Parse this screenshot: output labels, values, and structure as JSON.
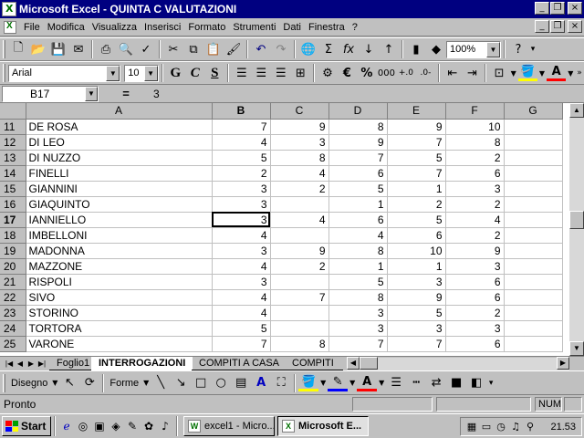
{
  "window": {
    "title": "Microsoft Excel - QUINTA C VALUTAZIONI"
  },
  "menu": [
    "File",
    "Modifica",
    "Visualizza",
    "Inserisci",
    "Formato",
    "Strumenti",
    "Dati",
    "Finestra",
    "?"
  ],
  "toolbar": {
    "zoom": "100%"
  },
  "format": {
    "font": "Arial",
    "size": "10",
    "bold": "G",
    "italic": "C",
    "underline": "S",
    "currency": "€",
    "percent": "%",
    "thousands": "000"
  },
  "formula": {
    "cell_ref": "B17",
    "equals": "=",
    "value": "3"
  },
  "columns": [
    "A",
    "B",
    "C",
    "D",
    "E",
    "F",
    "G"
  ],
  "rows": [
    {
      "n": "11",
      "a": "DE ROSA",
      "b": "7",
      "c": "9",
      "d": "8",
      "e": "9",
      "f": "10"
    },
    {
      "n": "12",
      "a": "DI LEO",
      "b": "4",
      "c": "3",
      "d": "9",
      "e": "7",
      "f": "8"
    },
    {
      "n": "13",
      "a": "DI NUZZO",
      "b": "5",
      "c": "8",
      "d": "7",
      "e": "5",
      "f": "2"
    },
    {
      "n": "14",
      "a": "FINELLI",
      "b": "2",
      "c": "4",
      "d": "6",
      "e": "7",
      "f": "6"
    },
    {
      "n": "15",
      "a": "GIANNINI",
      "b": "3",
      "c": "2",
      "d": "5",
      "e": "1",
      "f": "3"
    },
    {
      "n": "16",
      "a": "GIAQUINTO",
      "b": "3",
      "c": "",
      "d": "1",
      "e": "2",
      "f": "2"
    },
    {
      "n": "17",
      "a": "IANNIELLO",
      "b": "3",
      "c": "4",
      "d": "6",
      "e": "5",
      "f": "4"
    },
    {
      "n": "18",
      "a": "IMBELLONI",
      "b": "4",
      "c": "",
      "d": "4",
      "e": "6",
      "f": "2"
    },
    {
      "n": "19",
      "a": "MADONNA",
      "b": "3",
      "c": "9",
      "d": "8",
      "e": "10",
      "f": "9"
    },
    {
      "n": "20",
      "a": "MAZZONE",
      "b": "4",
      "c": "2",
      "d": "1",
      "e": "1",
      "f": "3"
    },
    {
      "n": "21",
      "a": "RISPOLI",
      "b": "3",
      "c": "",
      "d": "5",
      "e": "3",
      "f": "6"
    },
    {
      "n": "22",
      "a": "SIVO",
      "b": "4",
      "c": "7",
      "d": "8",
      "e": "9",
      "f": "6"
    },
    {
      "n": "23",
      "a": "STORINO",
      "b": "4",
      "c": "",
      "d": "3",
      "e": "5",
      "f": "2"
    },
    {
      "n": "24",
      "a": "TORTORA",
      "b": "5",
      "c": "",
      "d": "3",
      "e": "3",
      "f": "3"
    },
    {
      "n": "25",
      "a": "VARONE",
      "b": "7",
      "c": "8",
      "d": "7",
      "e": "7",
      "f": "6"
    }
  ],
  "tabs": [
    "Foglio1",
    "INTERROGAZIONI",
    "COMPITI A CASA",
    "COMPITI IN"
  ],
  "drawing": {
    "draw_label": "Disegno",
    "shapes_label": "Forme"
  },
  "status": {
    "text": "Pronto",
    "num": "NUM"
  },
  "taskbar": {
    "start": "Start",
    "task1": "excel1 - Micro...",
    "task2": "Microsoft E...",
    "clock": "21.53"
  }
}
